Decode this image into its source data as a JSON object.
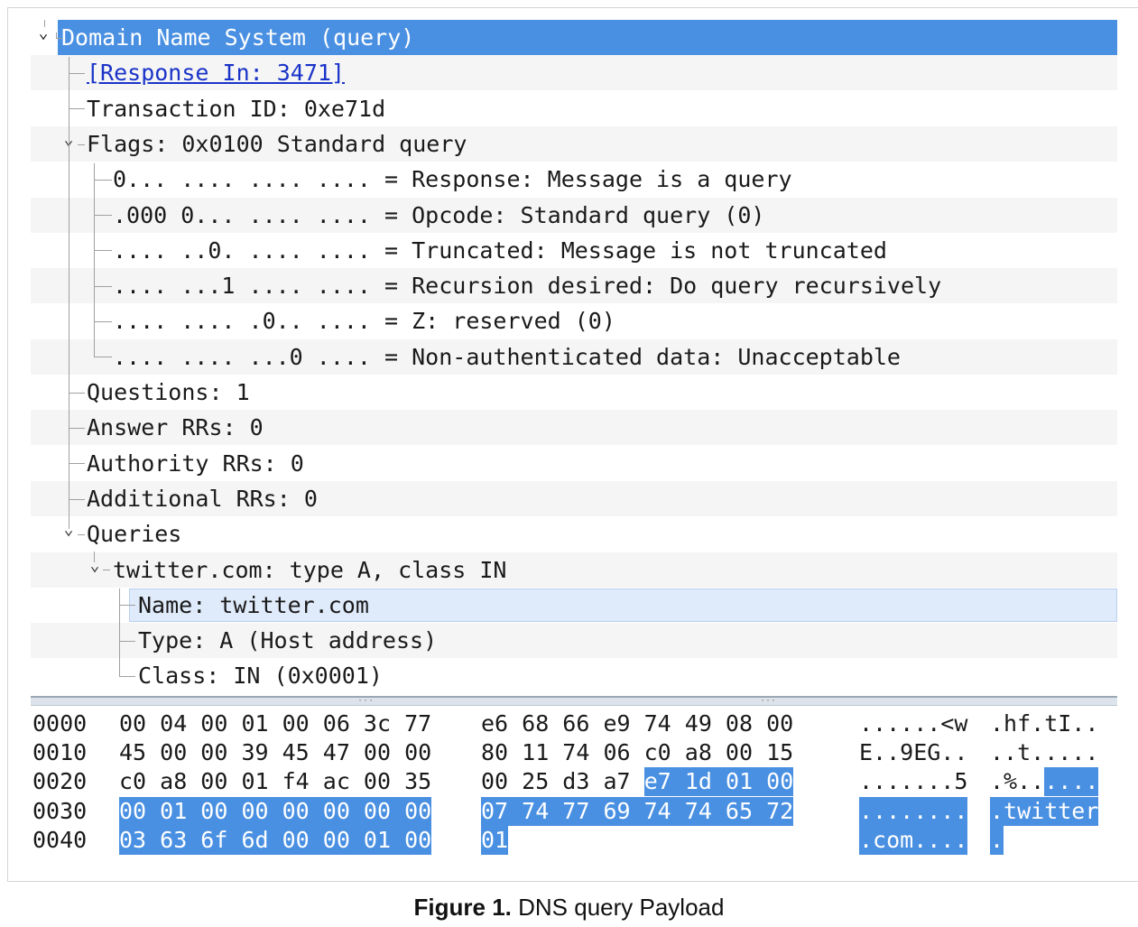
{
  "tree": {
    "rows": [
      {
        "text": "Domain Name System (query)",
        "depth": 0,
        "expand": "open",
        "selected": true
      },
      {
        "text": "[Response In: 3471]",
        "depth": 1,
        "link": true
      },
      {
        "text": "Transaction ID: 0xe71d",
        "depth": 1
      },
      {
        "text": "Flags: 0x0100 Standard query",
        "depth": 1,
        "expand": "open"
      },
      {
        "text": "0... .... .... .... = Response: Message is a query",
        "depth": 2
      },
      {
        "text": ".000 0... .... .... = Opcode: Standard query (0)",
        "depth": 2
      },
      {
        "text": ".... ..0. .... .... = Truncated: Message is not truncated",
        "depth": 2
      },
      {
        "text": ".... ...1 .... .... = Recursion desired: Do query recursively",
        "depth": 2
      },
      {
        "text": ".... .... .0.. .... = Z: reserved (0)",
        "depth": 2
      },
      {
        "text": ".... .... ...0 .... = Non-authenticated data: Unacceptable",
        "depth": 2
      },
      {
        "text": "Questions: 1",
        "depth": 1
      },
      {
        "text": "Answer RRs: 0",
        "depth": 1
      },
      {
        "text": "Authority RRs: 0",
        "depth": 1
      },
      {
        "text": "Additional RRs: 0",
        "depth": 1
      },
      {
        "text": "Queries",
        "depth": 1,
        "expand": "open"
      },
      {
        "text": "twitter.com: type A, class IN",
        "depth": 2,
        "expand": "open"
      },
      {
        "text": "Name: twitter.com",
        "depth": 3,
        "highlight": true
      },
      {
        "text": "Type: A (Host address)",
        "depth": 3
      },
      {
        "text": "Class: IN (0x0001)",
        "depth": 3
      }
    ]
  },
  "hex": {
    "rows": [
      {
        "offset": "0000",
        "b1": "00 04 00 01 00 06 3c 77",
        "b1s": "",
        "b2": "e6 68 66 e9 74 49 08 00",
        "b2s": "",
        "a1": "......<w",
        "a1s": "",
        "a2": ".hf.tI..",
        "a2s": ""
      },
      {
        "offset": "0010",
        "b1": "45 00 00 39 45 47 00 00",
        "b1s": "",
        "b2": "80 11 74 06 c0 a8 00 15",
        "b2s": "",
        "a1": "E..9EG..",
        "a1s": "",
        "a2": "..t.....",
        "a2s": ""
      },
      {
        "offset": "0020",
        "b1": "c0 a8 00 01 f4 ac 00 35",
        "b1s": "",
        "b2": "00 25 d3 a7 ",
        "b2s": "e7 1d 01 00",
        "a1": ".......5",
        "a1s": "",
        "a2": ".%..",
        "a2s": "...."
      },
      {
        "offset": "0030",
        "b1": "",
        "b1s": "00 01 00 00 00 00 00 00",
        "b2": "",
        "b2s": "07 74 77 69 74 74 65 72",
        "a1": "",
        "a1s": "........",
        "a2": "",
        "a2s": ".twitter"
      },
      {
        "offset": "0040",
        "b1": "",
        "b1s": "03 63 6f 6d 00 00 01 00",
        "b2": "",
        "b2s": "01",
        "a1": "",
        "a1s": ".com....",
        "a2": "",
        "a2s": "."
      }
    ]
  },
  "caption": {
    "label": "Figure 1.",
    "text": " DNS query Payload"
  },
  "icons": {
    "expanded": "chevron-down-icon",
    "splitter_grip": "grip-dots-icon"
  },
  "colors": {
    "selection": "#4a90e2",
    "link": "#1a33c8",
    "row_alt": "#f5f5f5"
  }
}
